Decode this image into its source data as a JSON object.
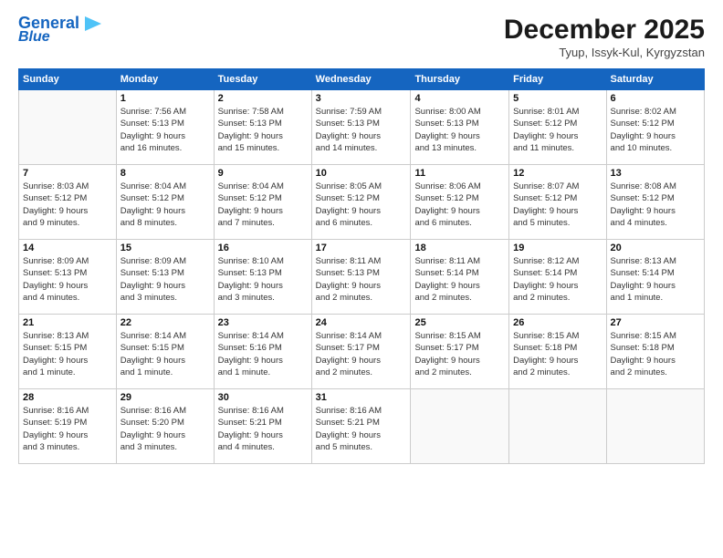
{
  "header": {
    "logo_line1": "General",
    "logo_line2": "Blue",
    "month": "December 2025",
    "location": "Tyup, Issyk-Kul, Kyrgyzstan"
  },
  "weekdays": [
    "Sunday",
    "Monday",
    "Tuesday",
    "Wednesday",
    "Thursday",
    "Friday",
    "Saturday"
  ],
  "weeks": [
    [
      {
        "num": "",
        "info": ""
      },
      {
        "num": "1",
        "info": "Sunrise: 7:56 AM\nSunset: 5:13 PM\nDaylight: 9 hours\nand 16 minutes."
      },
      {
        "num": "2",
        "info": "Sunrise: 7:58 AM\nSunset: 5:13 PM\nDaylight: 9 hours\nand 15 minutes."
      },
      {
        "num": "3",
        "info": "Sunrise: 7:59 AM\nSunset: 5:13 PM\nDaylight: 9 hours\nand 14 minutes."
      },
      {
        "num": "4",
        "info": "Sunrise: 8:00 AM\nSunset: 5:13 PM\nDaylight: 9 hours\nand 13 minutes."
      },
      {
        "num": "5",
        "info": "Sunrise: 8:01 AM\nSunset: 5:12 PM\nDaylight: 9 hours\nand 11 minutes."
      },
      {
        "num": "6",
        "info": "Sunrise: 8:02 AM\nSunset: 5:12 PM\nDaylight: 9 hours\nand 10 minutes."
      }
    ],
    [
      {
        "num": "7",
        "info": "Sunrise: 8:03 AM\nSunset: 5:12 PM\nDaylight: 9 hours\nand 9 minutes."
      },
      {
        "num": "8",
        "info": "Sunrise: 8:04 AM\nSunset: 5:12 PM\nDaylight: 9 hours\nand 8 minutes."
      },
      {
        "num": "9",
        "info": "Sunrise: 8:04 AM\nSunset: 5:12 PM\nDaylight: 9 hours\nand 7 minutes."
      },
      {
        "num": "10",
        "info": "Sunrise: 8:05 AM\nSunset: 5:12 PM\nDaylight: 9 hours\nand 6 minutes."
      },
      {
        "num": "11",
        "info": "Sunrise: 8:06 AM\nSunset: 5:12 PM\nDaylight: 9 hours\nand 6 minutes."
      },
      {
        "num": "12",
        "info": "Sunrise: 8:07 AM\nSunset: 5:12 PM\nDaylight: 9 hours\nand 5 minutes."
      },
      {
        "num": "13",
        "info": "Sunrise: 8:08 AM\nSunset: 5:12 PM\nDaylight: 9 hours\nand 4 minutes."
      }
    ],
    [
      {
        "num": "14",
        "info": "Sunrise: 8:09 AM\nSunset: 5:13 PM\nDaylight: 9 hours\nand 4 minutes."
      },
      {
        "num": "15",
        "info": "Sunrise: 8:09 AM\nSunset: 5:13 PM\nDaylight: 9 hours\nand 3 minutes."
      },
      {
        "num": "16",
        "info": "Sunrise: 8:10 AM\nSunset: 5:13 PM\nDaylight: 9 hours\nand 3 minutes."
      },
      {
        "num": "17",
        "info": "Sunrise: 8:11 AM\nSunset: 5:13 PM\nDaylight: 9 hours\nand 2 minutes."
      },
      {
        "num": "18",
        "info": "Sunrise: 8:11 AM\nSunset: 5:14 PM\nDaylight: 9 hours\nand 2 minutes."
      },
      {
        "num": "19",
        "info": "Sunrise: 8:12 AM\nSunset: 5:14 PM\nDaylight: 9 hours\nand 2 minutes."
      },
      {
        "num": "20",
        "info": "Sunrise: 8:13 AM\nSunset: 5:14 PM\nDaylight: 9 hours\nand 1 minute."
      }
    ],
    [
      {
        "num": "21",
        "info": "Sunrise: 8:13 AM\nSunset: 5:15 PM\nDaylight: 9 hours\nand 1 minute."
      },
      {
        "num": "22",
        "info": "Sunrise: 8:14 AM\nSunset: 5:15 PM\nDaylight: 9 hours\nand 1 minute."
      },
      {
        "num": "23",
        "info": "Sunrise: 8:14 AM\nSunset: 5:16 PM\nDaylight: 9 hours\nand 1 minute."
      },
      {
        "num": "24",
        "info": "Sunrise: 8:14 AM\nSunset: 5:17 PM\nDaylight: 9 hours\nand 2 minutes."
      },
      {
        "num": "25",
        "info": "Sunrise: 8:15 AM\nSunset: 5:17 PM\nDaylight: 9 hours\nand 2 minutes."
      },
      {
        "num": "26",
        "info": "Sunrise: 8:15 AM\nSunset: 5:18 PM\nDaylight: 9 hours\nand 2 minutes."
      },
      {
        "num": "27",
        "info": "Sunrise: 8:15 AM\nSunset: 5:18 PM\nDaylight: 9 hours\nand 2 minutes."
      }
    ],
    [
      {
        "num": "28",
        "info": "Sunrise: 8:16 AM\nSunset: 5:19 PM\nDaylight: 9 hours\nand 3 minutes."
      },
      {
        "num": "29",
        "info": "Sunrise: 8:16 AM\nSunset: 5:20 PM\nDaylight: 9 hours\nand 3 minutes."
      },
      {
        "num": "30",
        "info": "Sunrise: 8:16 AM\nSunset: 5:21 PM\nDaylight: 9 hours\nand 4 minutes."
      },
      {
        "num": "31",
        "info": "Sunrise: 8:16 AM\nSunset: 5:21 PM\nDaylight: 9 hours\nand 5 minutes."
      },
      {
        "num": "",
        "info": ""
      },
      {
        "num": "",
        "info": ""
      },
      {
        "num": "",
        "info": ""
      }
    ]
  ]
}
